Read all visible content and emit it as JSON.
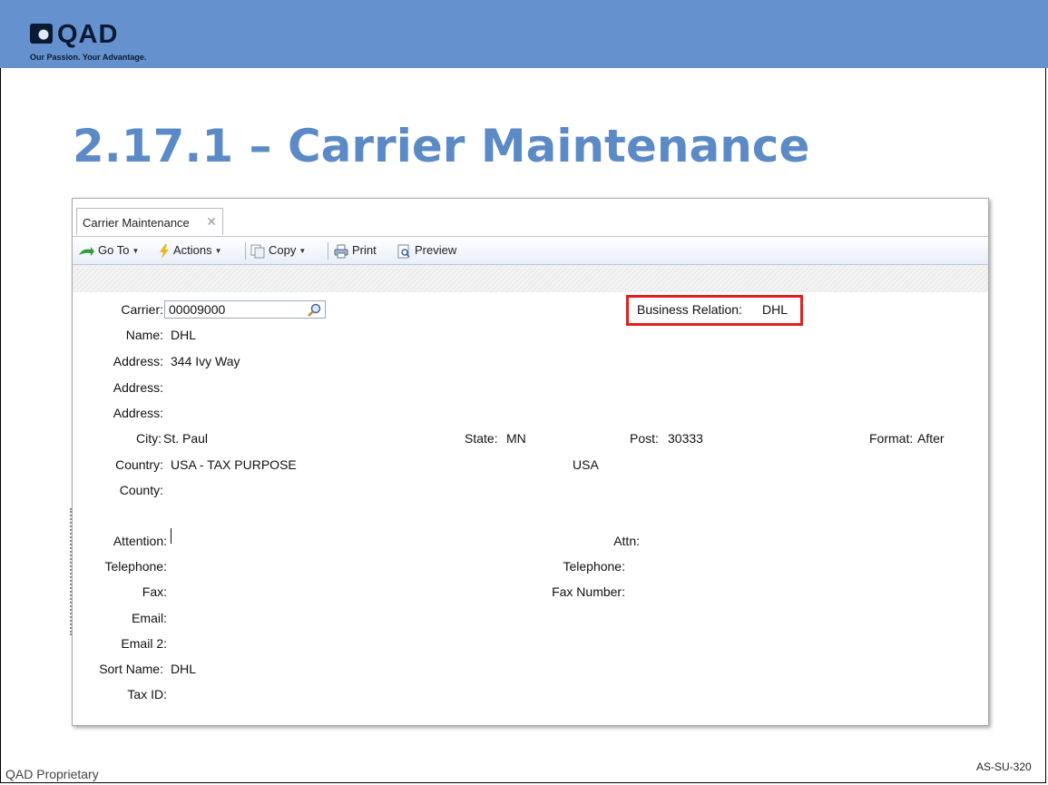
{
  "branding": {
    "logo_text": "QAD",
    "tagline": "Our Passion. Your Advantage.",
    "bar_color": "#6592ce",
    "title_color": "#5b8ac6"
  },
  "slide": {
    "title": "2.17.1 – Carrier Maintenance",
    "footer_left": "QAD Proprietary",
    "footer_right": "AS-SU-320"
  },
  "window": {
    "tab_label": "Carrier Maintenance",
    "tab_close_icon": "close-icon",
    "toolbar": {
      "goto_label": "Go To",
      "actions_label": "Actions",
      "copy_label": "Copy",
      "print_label": "Print",
      "preview_label": "Preview"
    }
  },
  "form": {
    "carrier_label": "Carrier:",
    "carrier_value": "00009000",
    "business_relation_label": "Business Relation:",
    "business_relation_value": "DHL",
    "name_label": "Name:",
    "name_value": "DHL",
    "address1_label": "Address:",
    "address1_value": "344 Ivy Way",
    "address2_label": "Address:",
    "address3_label": "Address:",
    "city_label": "City:",
    "city_value": "St. Paul",
    "state_label": "State:",
    "state_value": "MN",
    "post_label": "Post:",
    "post_value": "30333",
    "format_label": "Format:",
    "format_value": "After",
    "country_label": "Country:",
    "country_value": "USA - TAX PURPOSE",
    "country_code_value": "USA",
    "county_label": "County:",
    "attention_label": "Attention:",
    "attn_label": "Attn:",
    "telephone_label": "Telephone:",
    "telephone2_label": "Telephone:",
    "fax_label": "Fax:",
    "fax_number_label": "Fax Number:",
    "email_label": "Email:",
    "email2_label": "Email 2:",
    "sort_name_label": "Sort Name:",
    "sort_name_value": "DHL",
    "tax_id_label": "Tax ID:"
  }
}
